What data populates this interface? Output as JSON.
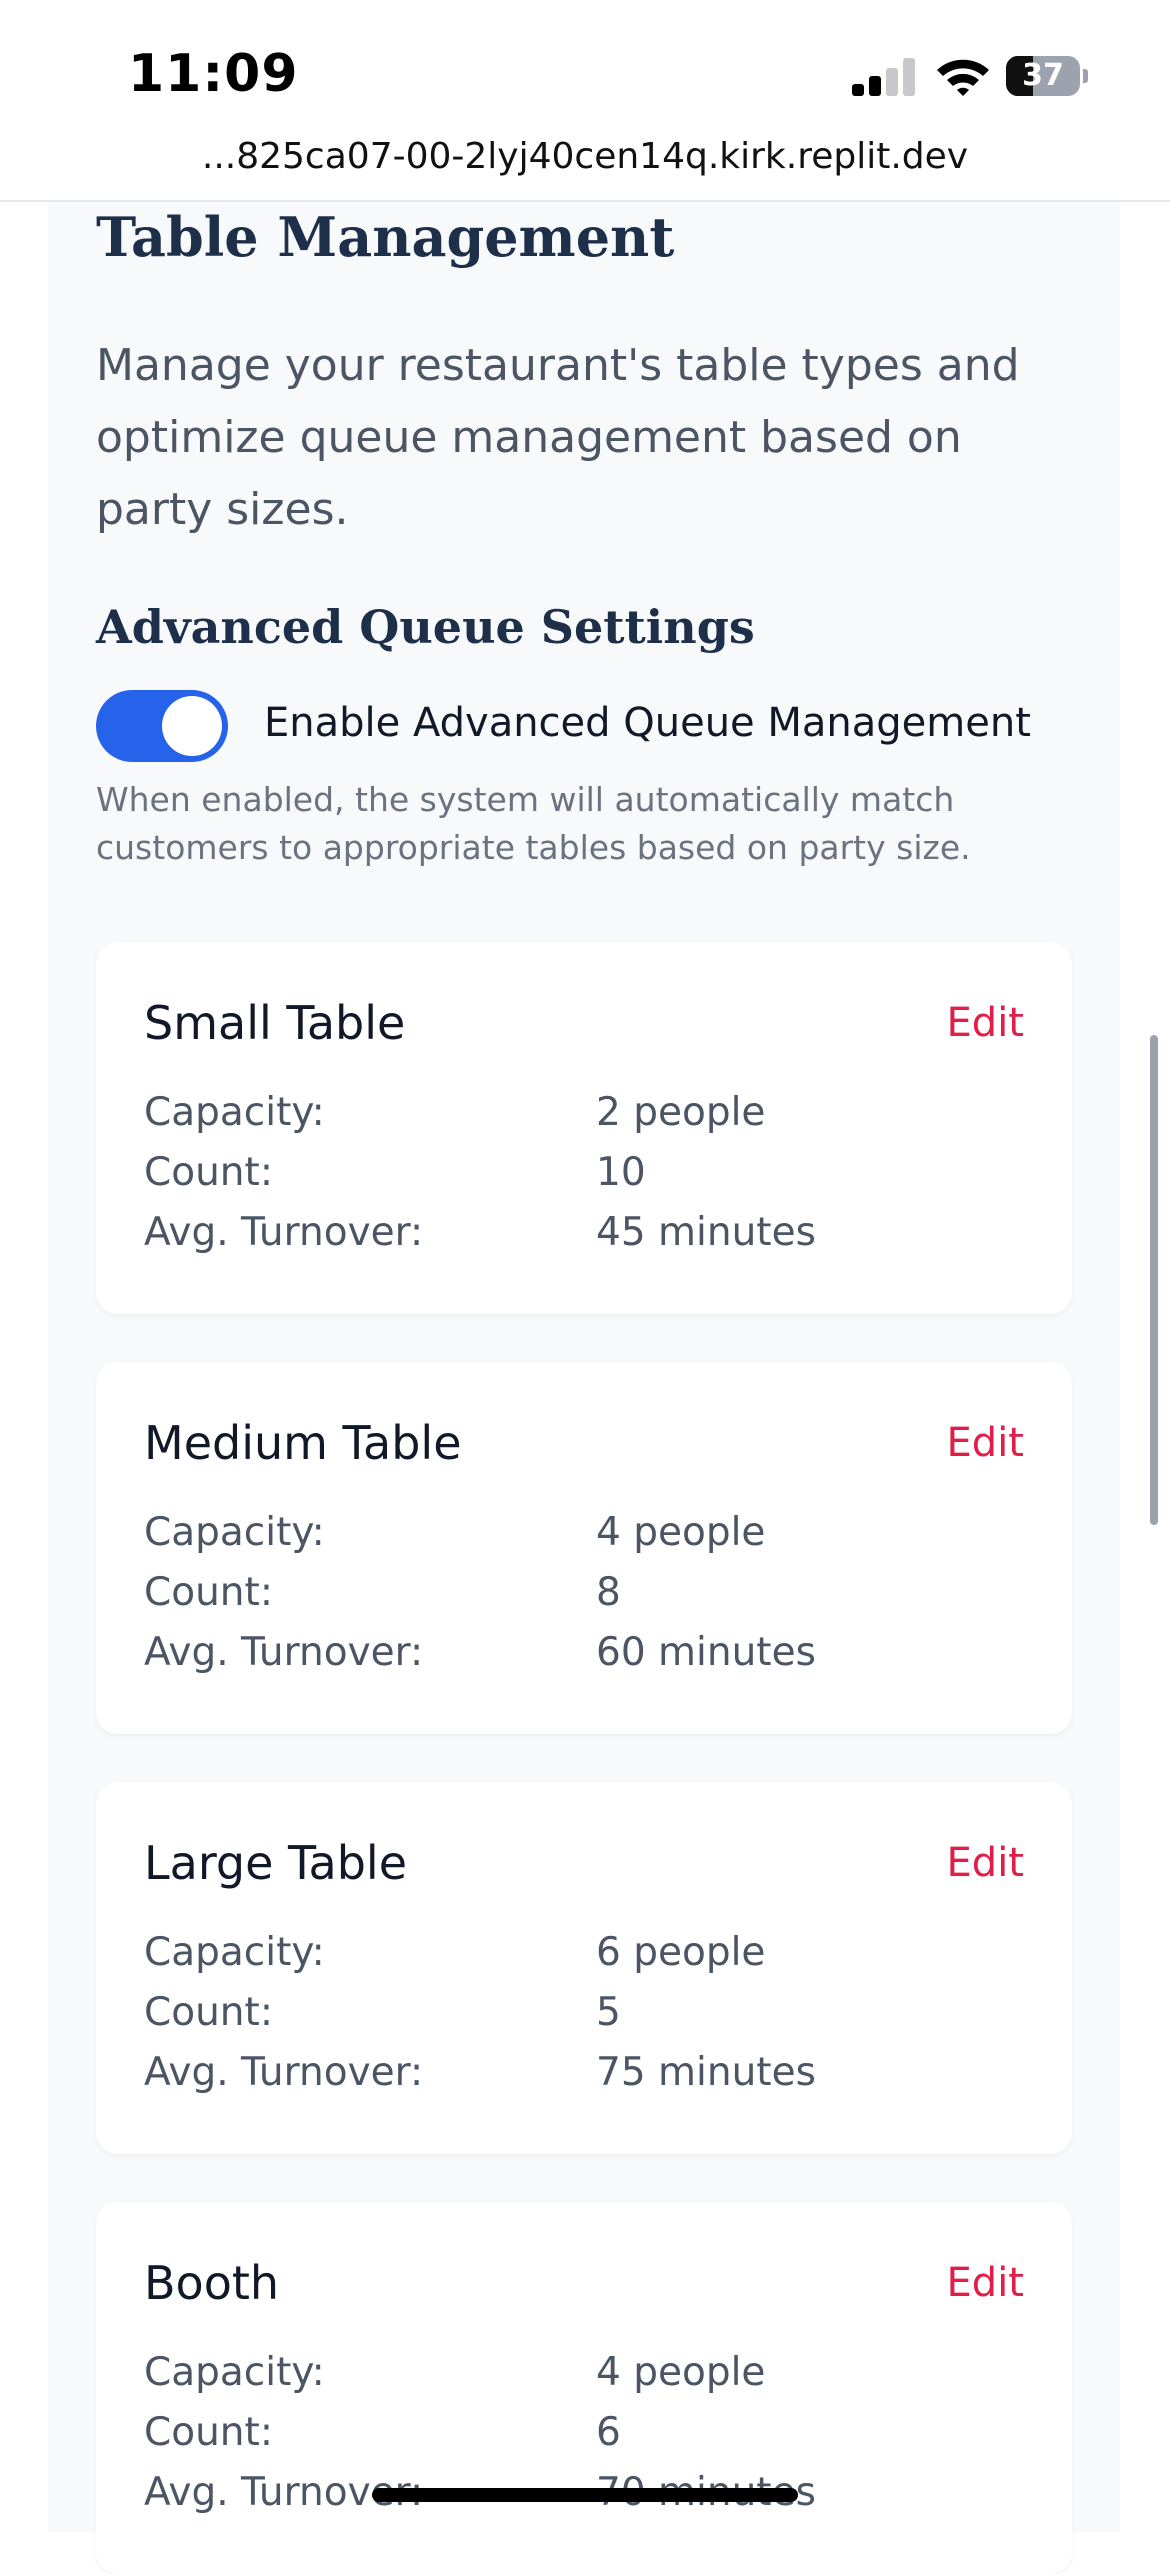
{
  "status_bar": {
    "time": "11:09",
    "battery": "37",
    "battery_level": 0.37
  },
  "browser": {
    "url": "...825ca07-00-2lyj40cen14q.kirk.replit.dev"
  },
  "page": {
    "title": "Table Management",
    "description": "Manage your restaurant's table types and optimize queue management based on party sizes."
  },
  "queue_settings": {
    "title": "Advanced Queue Settings",
    "toggle_label": "Enable Advanced Queue Management",
    "toggle_on": true,
    "help": "When enabled, the system will automatically match customers to appropriate tables based on party size."
  },
  "labels": {
    "capacity": "Capacity:",
    "count": "Count:",
    "turnover": "Avg. Turnover:",
    "edit": "Edit"
  },
  "tables": [
    {
      "name": "Small Table",
      "capacity": "2 people",
      "count": "10",
      "turnover": "45 minutes"
    },
    {
      "name": "Medium Table",
      "capacity": "4 people",
      "count": "8",
      "turnover": "60 minutes"
    },
    {
      "name": "Large Table",
      "capacity": "6 people",
      "count": "5",
      "turnover": "75 minutes"
    },
    {
      "name": "Booth",
      "capacity": "4 people",
      "count": "6",
      "turnover": "70 minutes"
    }
  ],
  "colors": {
    "accent": "#2563eb",
    "edit": "#e11d48",
    "heading": "#1e2f4a"
  }
}
